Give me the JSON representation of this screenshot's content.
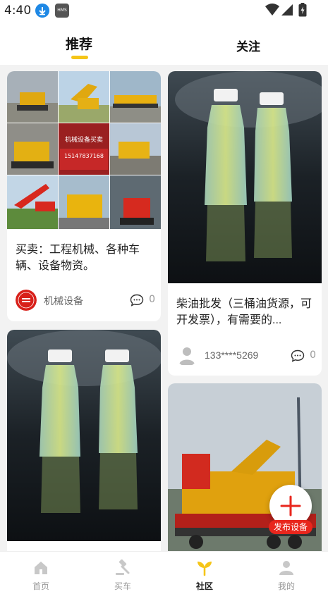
{
  "status_bar": {
    "time": "4:40",
    "hms_badge": "HMS",
    "icons": [
      "download-icon",
      "hms-icon",
      "wifi-icon",
      "cellular-icon",
      "battery-icon"
    ]
  },
  "header": {
    "tabs": [
      {
        "label": "推荐",
        "active": true
      },
      {
        "label": "关注",
        "active": false
      }
    ],
    "indicator_color": "#f5c518"
  },
  "feed": {
    "cards": [
      {
        "image": "machinery-collage",
        "image_text": "机械设备买卖 15147837168",
        "title": "买卖：工程机械、各种车辆、设备物资。",
        "author": "机械设备",
        "comments": "0"
      },
      {
        "image": "diesel-bottles",
        "title": "柴油批发（三桶油货源，可开发票），有需要的...",
        "author": "133****5269",
        "comments": "0"
      },
      {
        "image": "diesel-bottles"
      },
      {
        "image": "excavator-on-trailer"
      }
    ]
  },
  "fab": {
    "label": "发布设备",
    "icon": "plus-icon",
    "accent": "#e8261d"
  },
  "bottom_nav": {
    "items": [
      {
        "label": "首页",
        "icon": "home-icon",
        "active": false
      },
      {
        "label": "买车",
        "icon": "gavel-icon",
        "active": false
      },
      {
        "label": "社区",
        "icon": "sprout-icon",
        "active": true
      },
      {
        "label": "我的",
        "icon": "user-icon",
        "active": false
      }
    ],
    "active_color": "#f5c518"
  }
}
